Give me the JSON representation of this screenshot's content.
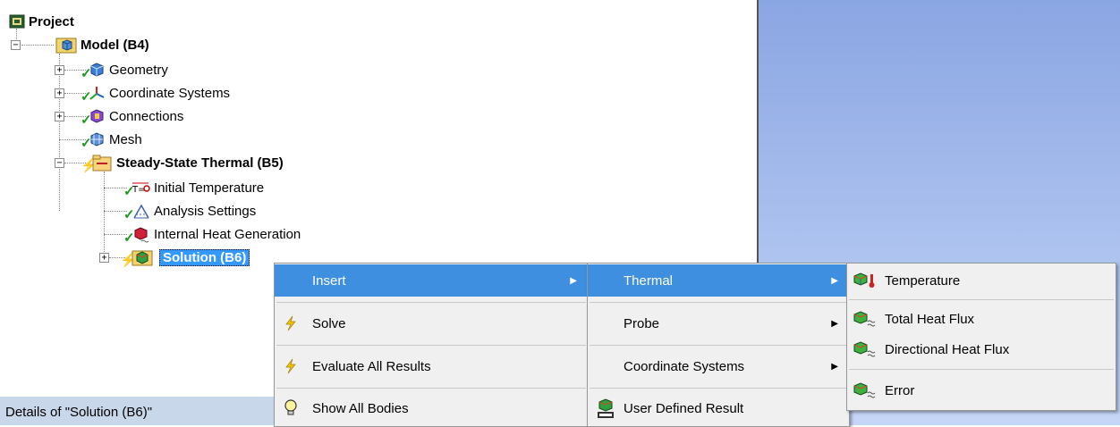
{
  "tree": {
    "project": "Project",
    "model": "Model (B4)",
    "geometry": "Geometry",
    "coordinate_systems": "Coordinate Systems",
    "connections": "Connections",
    "mesh": "Mesh",
    "thermal": "Steady-State Thermal (B5)",
    "initial_temperature": "Initial Temperature",
    "analysis_settings": "Analysis Settings",
    "internal_heat_generation": "Internal Heat Generation",
    "solution": "Solution (B6)"
  },
  "status": {
    "details": "Details of \"Solution (B6)\""
  },
  "context_menu": {
    "insert": "Insert",
    "solve": "Solve",
    "evaluate": "Evaluate All Results",
    "show_bodies": "Show All Bodies"
  },
  "insert_menu": {
    "thermal": "Thermal",
    "probe": "Probe",
    "coordinate_systems": "Coordinate Systems",
    "user_defined": "User Defined Result"
  },
  "thermal_menu": {
    "temperature": "Temperature",
    "total_heat_flux": "Total Heat Flux",
    "directional_heat_flux": "Directional Heat Flux",
    "error": "Error"
  },
  "icons": {
    "tree_expand": "plus-box",
    "tree_collapse": "minus-box",
    "status_ok": "green-check",
    "status_solve": "lightning-bolt",
    "submenu": "right-arrow"
  },
  "colors": {
    "selection": "#3399ff",
    "menu_highlight": "#3e8fe0",
    "status_bar": "#c9d7ea",
    "viewport_top": "#8aa5e3",
    "viewport_bottom": "#c6d6f6",
    "check": "#1a9a1a",
    "bolt": "#e8b400"
  }
}
